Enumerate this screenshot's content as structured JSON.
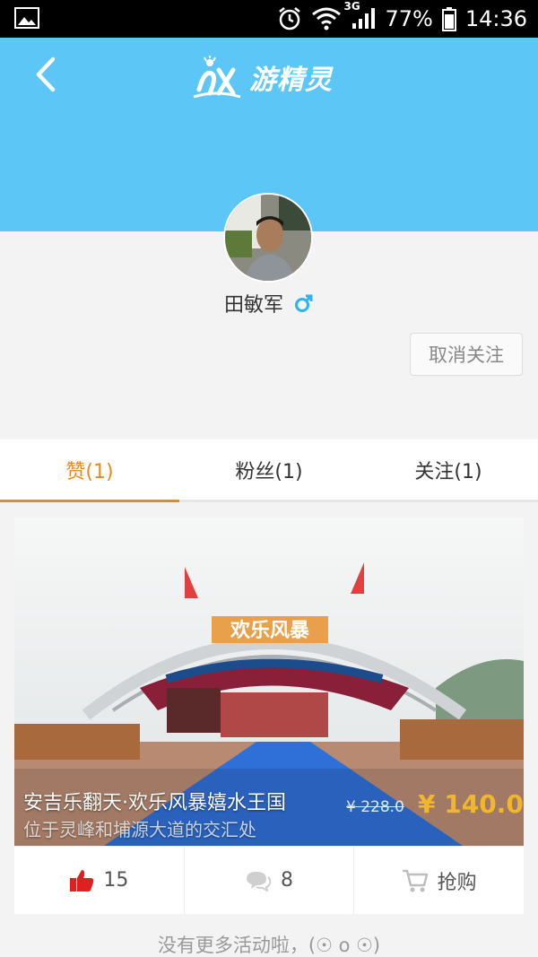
{
  "status_bar": {
    "battery": "77%",
    "time": "14:36",
    "network": "3G"
  },
  "header": {
    "logo_text": "游精灵",
    "back_icon": "chevron-left-icon"
  },
  "profile": {
    "name": "田敏军",
    "gender_icon": "male-icon",
    "unfollow_label": "取消关注"
  },
  "tabs": [
    {
      "label": "赞(1)",
      "active": true
    },
    {
      "label": "粉丝(1)",
      "active": false
    },
    {
      "label": "关注(1)",
      "active": false
    }
  ],
  "card": {
    "title": "安吉乐翻天·欢乐风暴嬉水王国",
    "address": "位于灵峰和埔源大道的交汇处",
    "old_price": "¥ 228.0",
    "new_price": "¥ 140.0",
    "banner_text": "欢乐风暴",
    "likes": "15",
    "comments": "8",
    "buy_label": "抢购"
  },
  "footer": {
    "note": "没有更多活动啦，(☉ o ☉)"
  },
  "colors": {
    "header": "#5cc7f7",
    "accent": "#e58a1f",
    "price": "#f1b72b",
    "like": "#e02020"
  }
}
